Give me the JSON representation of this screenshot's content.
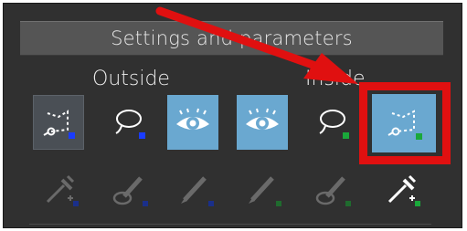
{
  "header": {
    "title": "Settings and parameters"
  },
  "groups": {
    "outside_label": "Outside",
    "inside_label": "Inside"
  },
  "colors": {
    "panel_bg": "#303030",
    "header_bg": "#555555",
    "active_tool_bg": "#6aa8d0",
    "selected_tool_bg": "#4a4f55",
    "outside_indicator": "#1a3cff",
    "inside_indicator": "#1aa83a",
    "highlight": "#e01010"
  },
  "tools_top": [
    {
      "icon": "polygon-lasso-icon",
      "group": "outside",
      "state": "selected"
    },
    {
      "icon": "lasso-icon",
      "group": "outside",
      "state": "normal"
    },
    {
      "icon": "eye-icon",
      "group": "outside",
      "state": "active"
    },
    {
      "icon": "eye-icon",
      "group": "inside",
      "state": "active"
    },
    {
      "icon": "lasso-icon",
      "group": "inside",
      "state": "normal"
    },
    {
      "icon": "polygon-lasso-icon",
      "group": "inside",
      "state": "active"
    }
  ],
  "tools_bottom": [
    {
      "icon": "eyedropper-plus-icon",
      "group": "outside",
      "enabled": false
    },
    {
      "icon": "brush-icon",
      "group": "outside",
      "enabled": false
    },
    {
      "icon": "pencil-icon",
      "group": "outside",
      "enabled": false
    },
    {
      "icon": "pencil-icon",
      "group": "inside",
      "enabled": false
    },
    {
      "icon": "brush-icon",
      "group": "inside",
      "enabled": false
    },
    {
      "icon": "eyedropper-plus-icon",
      "group": "inside",
      "enabled": true
    }
  ]
}
